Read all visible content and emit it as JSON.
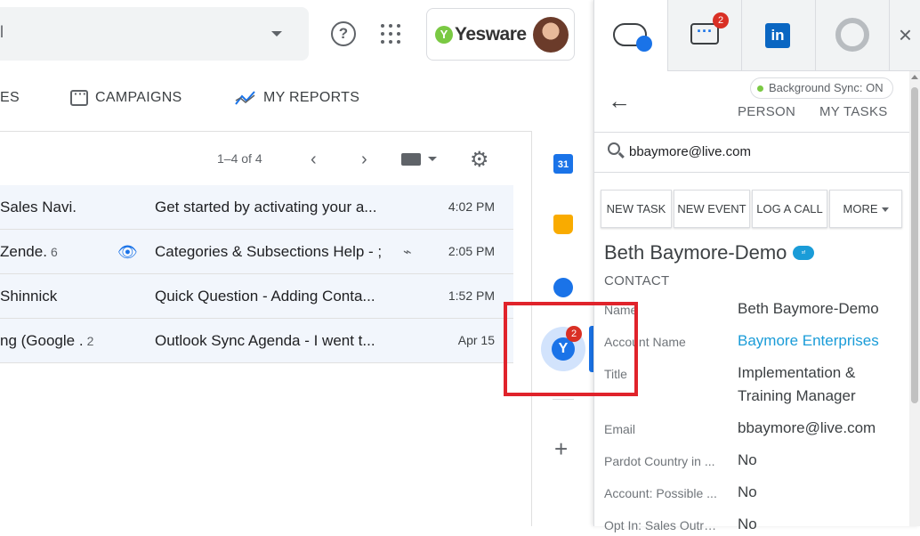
{
  "gmail": {
    "search_partial": "l",
    "tabs": [
      {
        "label": "ES"
      },
      {
        "label": "CAMPAIGNS"
      },
      {
        "label": "MY REPORTS"
      }
    ],
    "pager": "1–4 of 4",
    "emails": [
      {
        "sender": "Sales Navi.",
        "count": "",
        "subject": "Get started by activating your a...",
        "time": "4:02 PM"
      },
      {
        "sender": "Zende.",
        "count": "6",
        "subject": "Categories & Subsections Help - ;",
        "time": "2:05 PM"
      },
      {
        "sender": "Shinnick",
        "count": "",
        "subject": "Quick Question - Adding Conta...",
        "time": "1:52 PM"
      },
      {
        "sender": "ng (Google .",
        "count": "2",
        "subject": "Outlook Sync Agenda - I went t...",
        "time": "Apr 15"
      }
    ]
  },
  "yesware_badge": {
    "logo_text": "Yesware"
  },
  "rail": {
    "calendar_day": "31",
    "yesware_badge_count": "2"
  },
  "panel": {
    "chat_badge_count": "2",
    "linkedin_text": "in",
    "sync_status": "Background Sync: ON",
    "links": {
      "person": "PERSON",
      "tasks": "MY TASKS"
    },
    "search_value": "bbaymore@live.com",
    "buttons": {
      "new_task": "NEW TASK",
      "new_event": "NEW EVENT",
      "log_call": "LOG A CALL",
      "more": "MORE"
    },
    "contact_name": "Beth Baymore-Demo",
    "contact_type": "CONTACT",
    "fields": [
      {
        "label": "Name",
        "value": "Beth Baymore-Demo"
      },
      {
        "label": "Account Name",
        "value": "Baymore Enterprises"
      },
      {
        "label": "Title",
        "value": "Implementation & Training Manager"
      },
      {
        "label": "Email",
        "value": "bbaymore@live.com"
      },
      {
        "label": "Pardot Country in ...",
        "value": "No"
      },
      {
        "label": "Account: Possible ...",
        "value": "No"
      },
      {
        "label": "Opt In: Sales Outre...",
        "value": "No"
      }
    ]
  },
  "colors": {
    "accent": "#1a73e8",
    "highlight": "#e0232b",
    "salesforce": "#1a9cd8",
    "sync_dot": "#7ac943"
  }
}
